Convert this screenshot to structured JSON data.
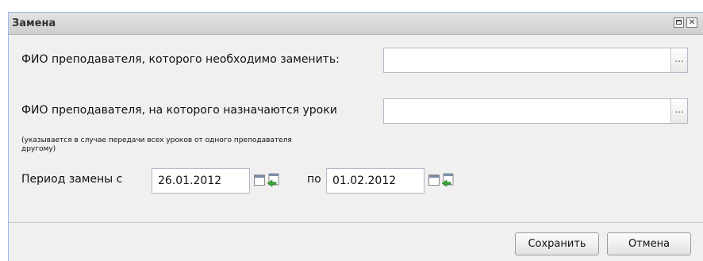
{
  "window": {
    "title": "Замена"
  },
  "form": {
    "teacher_replace_label": "ФИО преподавателя, которого необходимо заменить:",
    "teacher_replace_value": "",
    "teacher_assign_label": "ФИО преподавателя, на которого назначаются уроки",
    "teacher_assign_hint": "(указывается в случае передачи всех уроков от одного преподавателя другому)",
    "teacher_assign_value": "",
    "period_label": "Период замены с",
    "date_from": "26.01.2012",
    "po_label": "по",
    "date_to": "01.02.2012",
    "trigger_glyph": "..."
  },
  "buttons": {
    "save": "Сохранить",
    "cancel": "Отмена"
  },
  "icons": {
    "maximize": "maximize-icon",
    "close": "close-icon",
    "calendar": "calendar-icon",
    "clear": "clear-date-icon"
  },
  "colors": {
    "titlebar": "#d9d9d9",
    "panel": "#f0f0f0",
    "border": "#99bbe8"
  }
}
